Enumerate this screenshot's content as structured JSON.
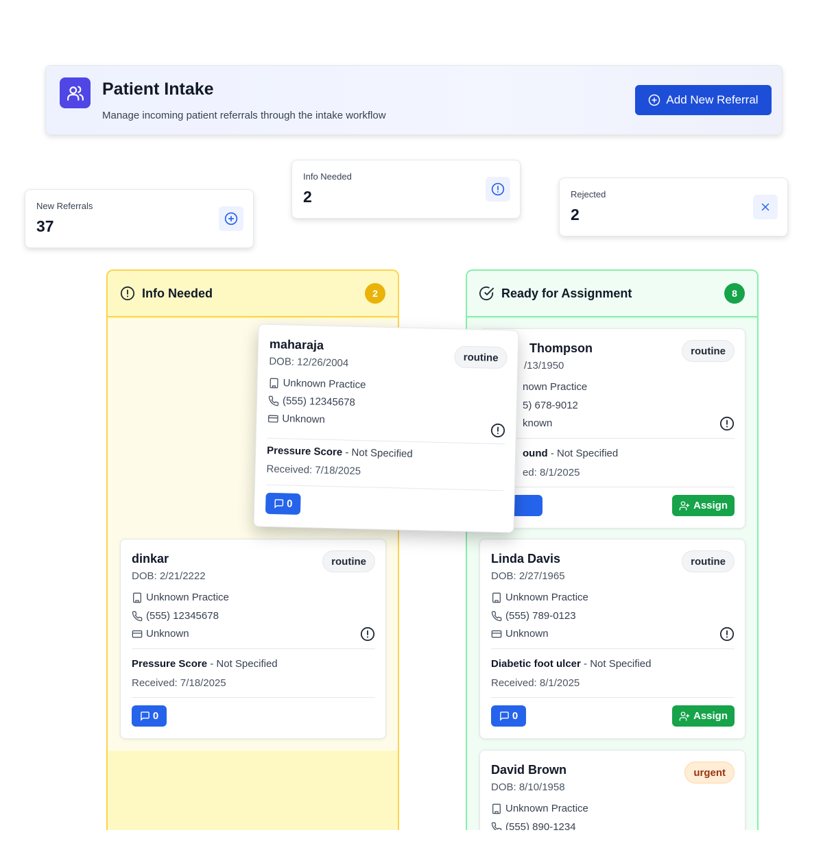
{
  "header": {
    "title": "Patient Intake",
    "subtitle": "Manage incoming patient referrals through the intake workflow",
    "add_button": "Add New Referral",
    "icon": "users-icon"
  },
  "stats": [
    {
      "label": "New Referrals",
      "value": "37",
      "icon": "plus-circle-icon"
    },
    {
      "label": "Info Needed",
      "value": "2",
      "icon": "alert-circle-icon"
    },
    {
      "label": "Rejected",
      "value": "2",
      "icon": "x-icon"
    }
  ],
  "columns": {
    "info_needed": {
      "title": "Info Needed",
      "count": "2",
      "accent": "#eab308"
    },
    "ready": {
      "title": "Ready for Assignment",
      "count": "8",
      "accent": "#16a34a"
    }
  },
  "dragged_card": {
    "name": "maharaja",
    "dob": "DOB: 12/26/2004",
    "practice": "Unknown Practice",
    "phone": "(555) 12345678",
    "insurance": "Unknown",
    "priority": "routine",
    "wound_type": "Pressure Score",
    "wound_detail": "- Not Specified",
    "received": "Received: 7/18/2025",
    "messages": "0"
  },
  "info_needed_cards": [
    {
      "name": "dinkar",
      "dob": "DOB: 2/21/2222",
      "practice": "Unknown Practice",
      "phone": "(555) 12345678",
      "insurance": "Unknown",
      "priority": "routine",
      "wound_type": "Pressure Score",
      "wound_detail": "- Not Specified",
      "received": "Received: 7/18/2025",
      "messages": "0"
    }
  ],
  "ready_cards": [
    {
      "name": "Thompson",
      "dob": "/13/1950",
      "practice": "nown Practice",
      "phone": "5) 678-9012",
      "insurance": "known",
      "priority": "routine",
      "wound_type": "ound",
      "wound_detail": "- Not Specified",
      "received": "ed: 8/1/2025",
      "assign": "Assign"
    },
    {
      "name": "Linda Davis",
      "dob": "DOB: 2/27/1965",
      "practice": "Unknown Practice",
      "phone": "(555) 789-0123",
      "insurance": "Unknown",
      "priority": "routine",
      "wound_type": "Diabetic foot ulcer",
      "wound_detail": "- Not Specified",
      "received": "Received: 8/1/2025",
      "messages": "0",
      "assign": "Assign"
    },
    {
      "name": "David Brown",
      "dob": "DOB: 8/10/1958",
      "practice": "Unknown Practice",
      "phone": "(555) 890-1234",
      "priority": "urgent"
    }
  ]
}
